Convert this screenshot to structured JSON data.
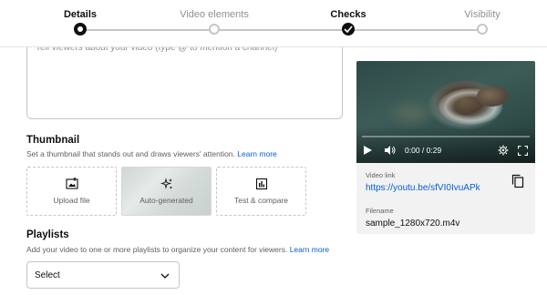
{
  "stepper": {
    "steps": [
      {
        "label": "Details",
        "state": "active"
      },
      {
        "label": "Video elements",
        "state": "pending"
      },
      {
        "label": "Checks",
        "state": "done"
      },
      {
        "label": "Visibility",
        "state": "pending"
      }
    ]
  },
  "description": {
    "placeholder": "Tell viewers about your video (type @ to mention a channel)"
  },
  "thumbnail": {
    "title": "Thumbnail",
    "subtitle": "Set a thumbnail that stands out and draws viewers' attention.",
    "learn_more": "Learn more",
    "options": [
      {
        "label": "Upload file",
        "icon": "image-upload-icon"
      },
      {
        "label": "Auto-generated",
        "icon": "sparkle-icon"
      },
      {
        "label": "Test & compare",
        "icon": "bar-chart-icon"
      }
    ]
  },
  "playlists": {
    "title": "Playlists",
    "subtitle": "Add your video to one or more playlists to organize your content for viewers.",
    "learn_more": "Learn more",
    "select_value": "Select"
  },
  "video": {
    "time": "0:00 / 0:29",
    "progress": 0,
    "link_label": "Video link",
    "link_value": "https://youtu.be/sfVI0IvuAPk",
    "filename_label": "Filename",
    "filename_value": "sample_1280x720.m4v"
  },
  "colors": {
    "accent_link": "#065fd4",
    "text_primary": "#0f0f0f",
    "text_secondary": "#606060",
    "border": "#c6c6c6"
  }
}
